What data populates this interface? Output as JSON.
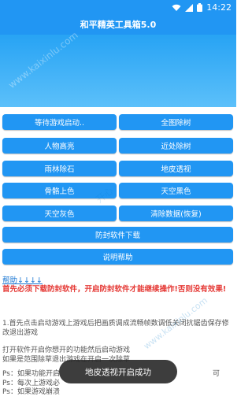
{
  "status_bar": {
    "time": "14:22",
    "icons": [
      "wifi-icon",
      "signal-icon",
      "battery-icon"
    ]
  },
  "app": {
    "title": "和平精英工具箱5.0",
    "accent_color": "#2196f3"
  },
  "watermarks": {
    "hero": "www.kaixinlu.com",
    "bottom": "www.kaixinlu.com",
    "middle": "开心"
  },
  "buttons": {
    "row1": {
      "left": "等待游戏启动..",
      "right": "全图除树"
    },
    "row2": {
      "left": "人物高亮",
      "right": "近处除树"
    },
    "row3": {
      "left": "雨林除石",
      "right": "地皮透视"
    },
    "row4": {
      "left": "骨骼上色",
      "right": "天空黑色"
    },
    "row5": {
      "left": "天空灰色",
      "right": "清除数据(恢复)"
    },
    "anti_ban": "防封软件下载",
    "help": "说明帮助"
  },
  "content": {
    "help_link": "帮助↓↓↓↓",
    "warning": "首先必须下载防封软件，开启防封软件才能继续操作!否则没有效果!",
    "para1": "1.首先点击启动游戏上游戏后把画质调成流畅帧数调低关闭抗锯齿保存修改退出游戏",
    "para2_line1": "打开软件开启你想开的功能然后启动游戏",
    "para2_line2": "如果是范围除草退出游戏在开启一次除草",
    "para3_line1": "Ps：如果功能开启",
    "para3_line1_tail": "可",
    "para3_line2": "Ps：每次上游戏必",
    "para3_line3": "Ps：如果游戏崩溃"
  },
  "toast": {
    "message": "地皮透视开启成功"
  }
}
